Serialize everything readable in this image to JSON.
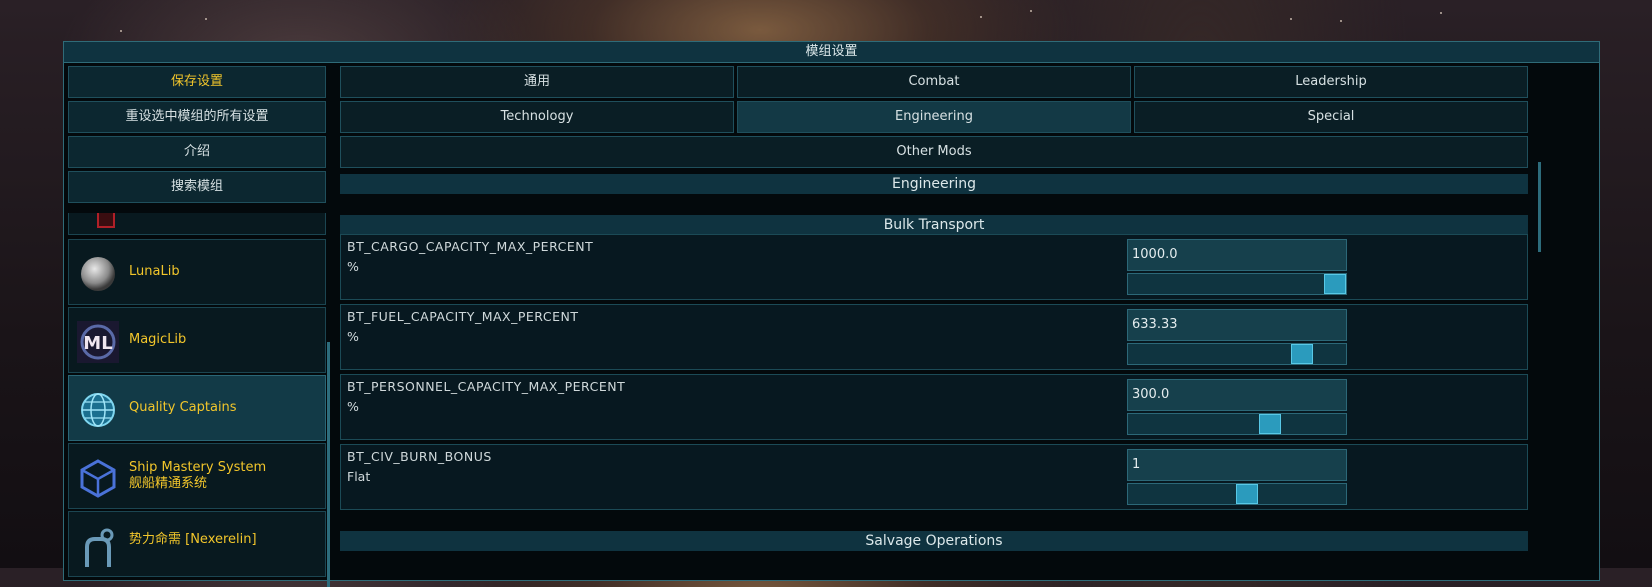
{
  "window": {
    "title": "模组设置"
  },
  "left_menu": {
    "buttons": [
      {
        "label": "保存设置",
        "active": true
      },
      {
        "label": "重设选中模组的所有设置",
        "active": false
      },
      {
        "label": "介绍",
        "active": false
      },
      {
        "label": "搜索模组",
        "active": false
      }
    ],
    "mods": [
      {
        "name": "",
        "icon": "red-mod-icon"
      },
      {
        "name": "LunaLib",
        "icon": "moon-icon"
      },
      {
        "name": "MagicLib",
        "icon": "magiclib-logo-icon"
      },
      {
        "name": "Quality Captains",
        "icon": "globe-icon",
        "selected": true
      },
      {
        "name": "Ship Mastery System",
        "name2": "舰船精通系统",
        "icon": "cube-icon"
      },
      {
        "name": "势力命需 [Nexerelin]",
        "icon": "nexerelin-icon"
      }
    ]
  },
  "tabs": [
    {
      "label": "通用"
    },
    {
      "label": "Combat"
    },
    {
      "label": "Leadership"
    },
    {
      "label": "Technology"
    },
    {
      "label": "Engineering",
      "active": true
    },
    {
      "label": "Special"
    },
    {
      "label": "Other Mods"
    }
  ],
  "section": {
    "title": "Engineering"
  },
  "groups": [
    {
      "title": "Bulk Transport",
      "settings": [
        {
          "key": "BT_CARGO_CAPACITY_MAX_PERCENT",
          "unit": "%",
          "value": "1000.0",
          "slider_fraction": 1.0
        },
        {
          "key": "BT_FUEL_CAPACITY_MAX_PERCENT",
          "unit": "%",
          "value": "633.33",
          "slider_fraction": 0.83
        },
        {
          "key": "BT_PERSONNEL_CAPACITY_MAX_PERCENT",
          "unit": "%",
          "value": "300.0",
          "slider_fraction": 0.67
        },
        {
          "key": "BT_CIV_BURN_BONUS",
          "unit": "Flat",
          "value": "1",
          "slider_fraction": 0.55
        }
      ]
    },
    {
      "title": "Salvage Operations"
    }
  ],
  "colors": {
    "accent": "#f2c62b",
    "panel": "#0f3340",
    "slider": "#2b9bbd"
  }
}
